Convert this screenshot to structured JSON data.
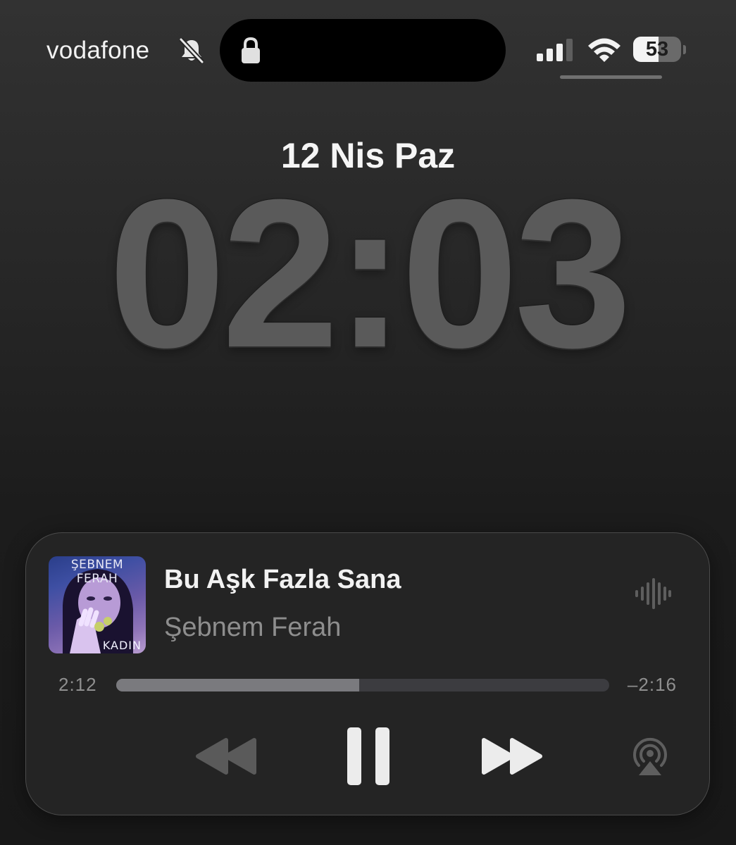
{
  "status_bar": {
    "carrier": "vodafone",
    "silent_icon": "bell-slash-icon",
    "lock_icon": "lock-icon",
    "signal_icon": "cellular-signal-icon",
    "wifi_icon": "wifi-icon",
    "battery_percent": "53",
    "battery_level": 0.53
  },
  "lock_screen": {
    "date": "12 Nis Paz",
    "time": "02:03"
  },
  "now_playing": {
    "album_art": {
      "artist_text": "ŞEBNEM FERAH",
      "album_text": "KADIN"
    },
    "title": "Bu Aşk Fazla Sana",
    "artist": "Şebnem Ferah",
    "waveform_icon": "waveform-icon",
    "elapsed": "2:12",
    "remaining": "–2:16",
    "progress": 0.493,
    "controls": {
      "rewind_icon": "rewind-icon",
      "pause_icon": "pause-icon",
      "forward_icon": "fast-forward-icon",
      "airplay_icon": "airplay-audio-icon"
    }
  },
  "colors": {
    "clock": "#5a5a5a",
    "player_background": "#242424",
    "secondary_text": "#8e8e8e",
    "progress_fill": "#7a7a7e",
    "progress_track": "#3c3c40"
  }
}
